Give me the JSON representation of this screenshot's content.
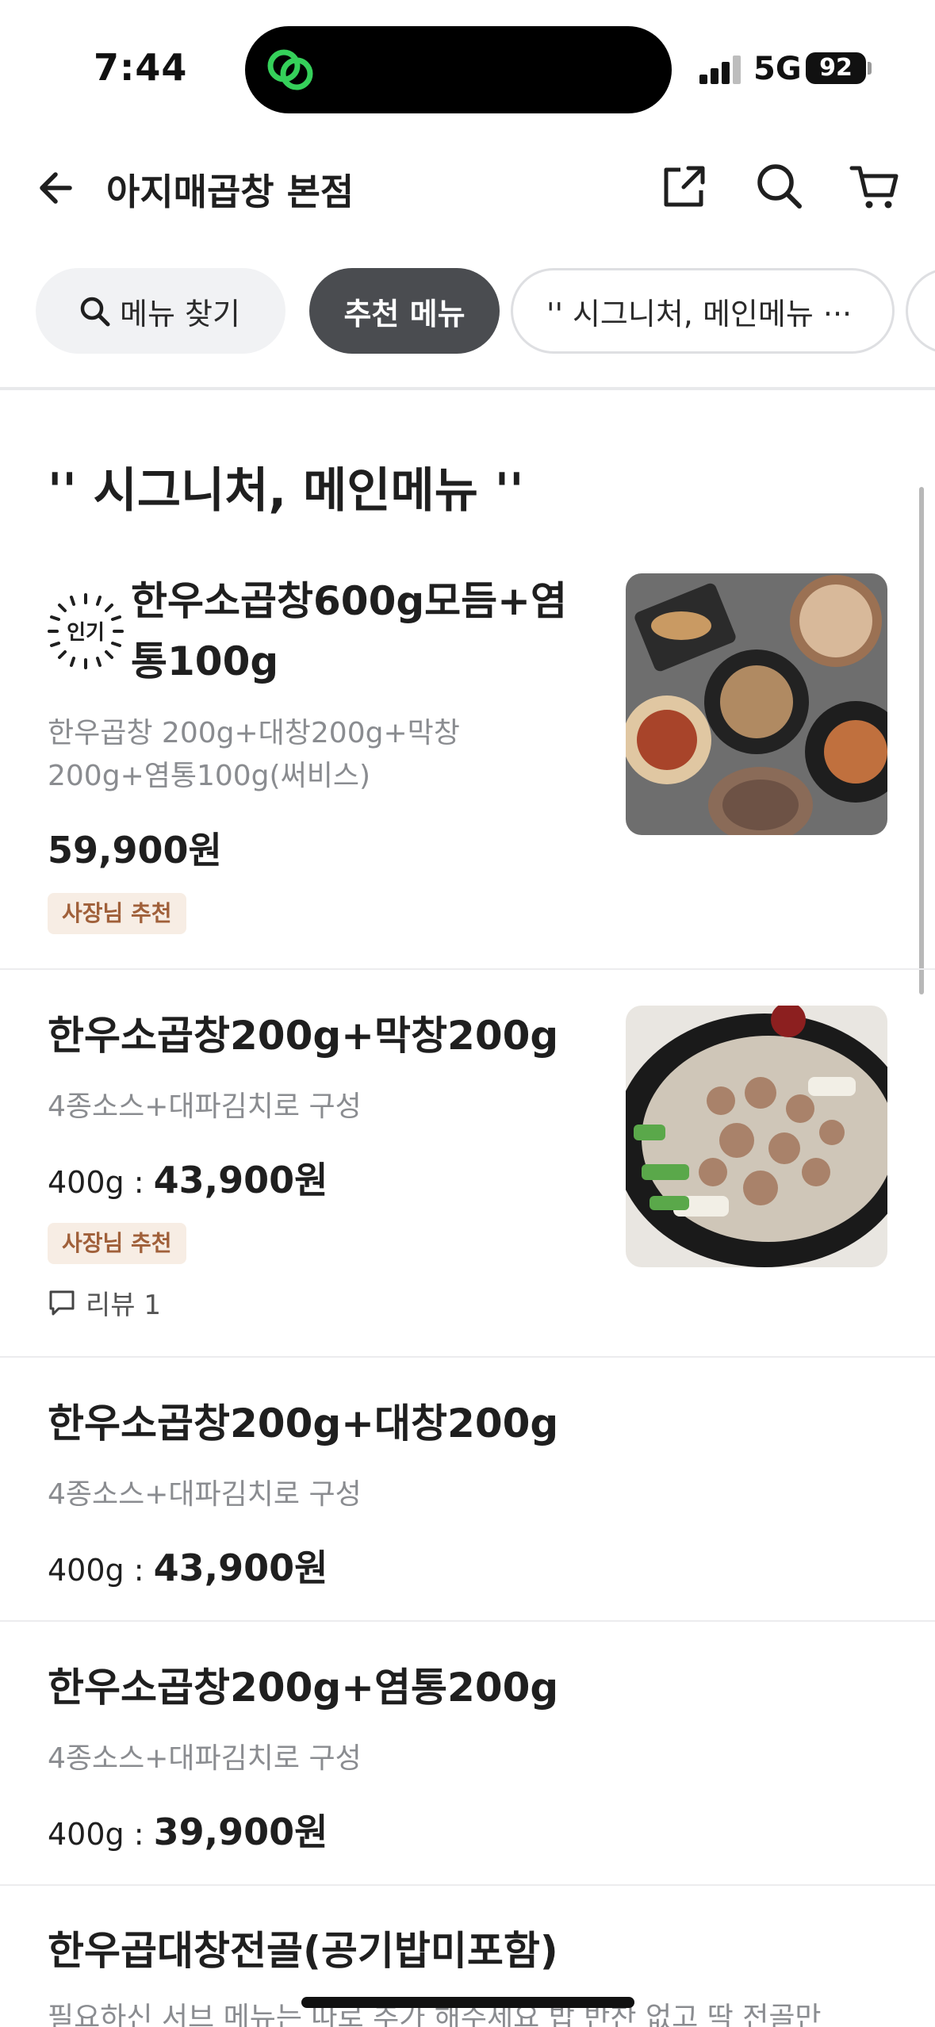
{
  "status_bar": {
    "time": "7:44",
    "network": "5G",
    "battery": "92"
  },
  "header": {
    "title": "아지매곱창 본점",
    "icons": [
      "back-arrow-icon",
      "share-icon",
      "search-icon",
      "cart-icon"
    ]
  },
  "chips": {
    "search_label": "메뉴 찾기",
    "active_label": "추천 메뉴",
    "category_label": "'' 시그니처, 메인메뉴 ···"
  },
  "section": {
    "title": "'' 시그니처, 메인메뉴 ''"
  },
  "popular_label": "인기",
  "items": [
    {
      "name_line1": "한우소곱창600g모듬+염",
      "name_line2": "통100g",
      "desc_line1": "한우곱창 200g+대창200g+막창",
      "desc_line2": "200g+염통100g(써비스)",
      "price": "59,900원",
      "badge": "사장님 추천"
    },
    {
      "name": "한우소곱창200g+막창200g",
      "desc": "4종소스+대파김치로 구성",
      "price_prefix": "400g : ",
      "price": "43,900원",
      "badge": "사장님 추천",
      "review": "리뷰 1"
    },
    {
      "name": "한우소곱창200g+대창200g",
      "desc": "4종소스+대파김치로 구성",
      "price_prefix": "400g : ",
      "price": "43,900원"
    },
    {
      "name": "한우소곱창200g+염통200g",
      "desc": "4종소스+대파김치로 구성",
      "price_prefix": "400g : ",
      "price": "39,900원"
    },
    {
      "name": "한우곱대창전골(공기밥미포함)",
      "desc": "필요하신 서브 메뉴는 따로 추가 해주세요 밥 반찬 없고 딱 전골만"
    }
  ],
  "colors": {
    "accent_dark": "#4a4c50",
    "badge_bg": "#f7ede4",
    "badge_text": "#a0603a",
    "muted_text": "#8a8c90"
  }
}
